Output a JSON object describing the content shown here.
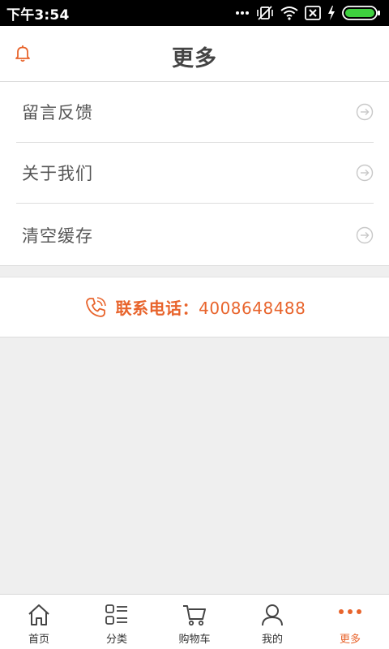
{
  "status_bar": {
    "time": "下午3:54",
    "icons": [
      "more-dots-icon",
      "vibrate-muted-icon",
      "wifi-icon",
      "sim-x-icon",
      "charging-icon",
      "battery-icon"
    ]
  },
  "header": {
    "title": "更多",
    "left_icon": "bell-icon"
  },
  "menu": {
    "items": [
      {
        "label": "留言反馈",
        "icon": "arrow-right-circle-icon"
      },
      {
        "label": "关于我们",
        "icon": "arrow-right-circle-icon"
      },
      {
        "label": "清空缓存",
        "icon": "arrow-right-circle-icon"
      }
    ]
  },
  "contact": {
    "icon": "phone-icon",
    "label": "联系电话：",
    "number": "4008648488"
  },
  "tabs": [
    {
      "label": "首页",
      "icon": "home-icon",
      "active": false
    },
    {
      "label": "分类",
      "icon": "category-list-icon",
      "active": false
    },
    {
      "label": "购物车",
      "icon": "cart-icon",
      "active": false
    },
    {
      "label": "我的",
      "icon": "user-icon",
      "active": false
    },
    {
      "label": "更多",
      "icon": "more-dots-icon",
      "active": true
    }
  ],
  "colors": {
    "accent": "#e8642c",
    "text": "#555555",
    "background": "#efefef"
  }
}
